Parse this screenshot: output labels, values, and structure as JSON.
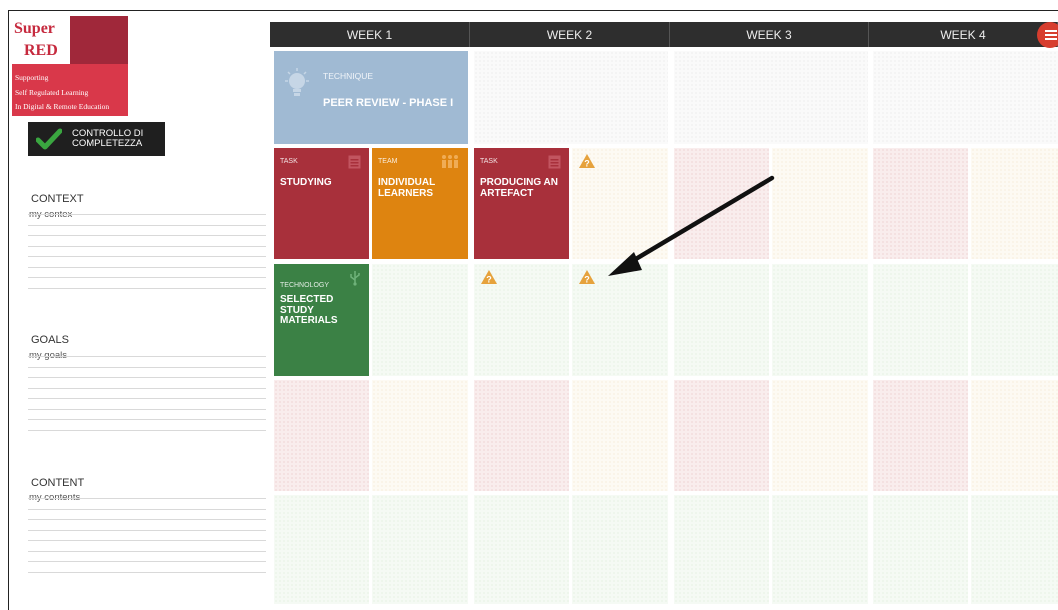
{
  "logo": {
    "line1": "Super",
    "line2": "RED",
    "sub1": "Supporting",
    "sub2": "Self Regulated Learning",
    "sub3": "In Digital & Remote Education"
  },
  "check_button": {
    "label_line1": "CONTROLLO DI",
    "label_line2": "COMPLETEZZA"
  },
  "sidebar": {
    "context": {
      "title": "CONTEXT",
      "value": "my contex"
    },
    "goals": {
      "title": "GOALS",
      "value": "my goals"
    },
    "content": {
      "title": "CONTENT",
      "value": "my contents"
    }
  },
  "weeks": [
    "WEEK 1",
    "WEEK 2",
    "WEEK 3",
    "WEEK 4"
  ],
  "cards": {
    "technique": {
      "type": "TECHNIQUE",
      "title": "PEER REVIEW - PHASE I",
      "color": "#a0bad3"
    },
    "task1": {
      "type": "TASK",
      "title": "STUDYING",
      "color": "#a8303b"
    },
    "team": {
      "type": "TEAM",
      "title": "INDIVIDUAL LEARNERS",
      "color": "#de8410"
    },
    "task2": {
      "type": "TASK",
      "title": "PRODUCING AN ARTEFACT",
      "color": "#a8303b"
    },
    "technology": {
      "type": "TECHNOLOGY",
      "title": "SELECTED STUDY MATERIALS",
      "color": "#3b8145"
    }
  },
  "colors": {
    "header": "#2e2e2e",
    "menu": "#d73d2e",
    "warning": "#e6a23c"
  }
}
